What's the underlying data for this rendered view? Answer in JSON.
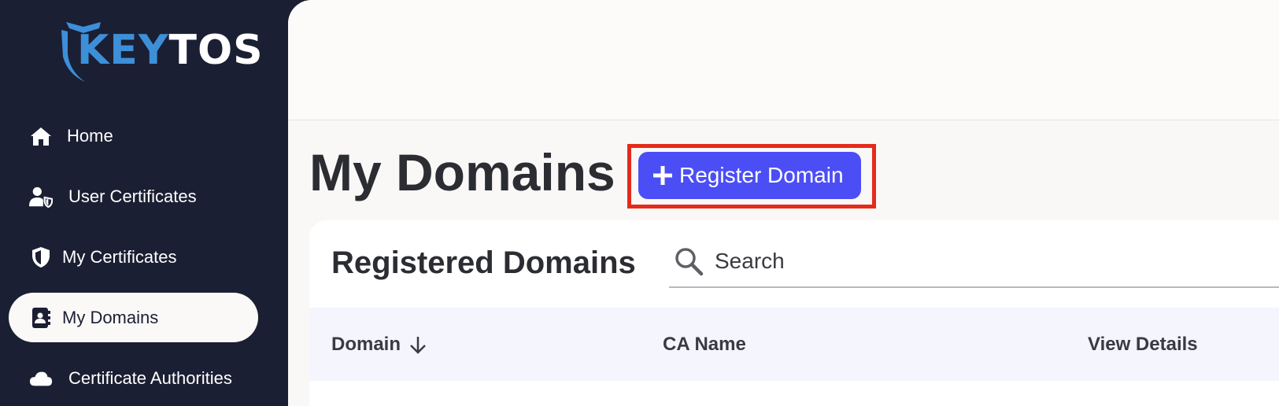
{
  "brand": {
    "logo_key": "KEY",
    "logo_tos": "TOS",
    "key_color": "#3d8fd8"
  },
  "sidebar": {
    "items": [
      {
        "label": "Home",
        "icon": "home-icon"
      },
      {
        "label": "User Certificates",
        "icon": "user-shield-icon"
      },
      {
        "label": "My Certificates",
        "icon": "shield-icon"
      },
      {
        "label": "My Domains",
        "icon": "contact-book-icon",
        "active": true
      },
      {
        "label": "Certificate Authorities",
        "icon": "cloud-icon"
      }
    ]
  },
  "main": {
    "page_title": "My Domains",
    "register_button": "Register Domain",
    "card": {
      "title": "Registered Domains",
      "search": {
        "placeholder": "Search",
        "value": ""
      },
      "columns": [
        "Domain",
        "CA Name",
        "View Details"
      ],
      "sort_column": "Domain",
      "sort_direction": "descending"
    }
  },
  "colors": {
    "sidebar_bg": "#1b1f33",
    "accent_button": "#4b4ef5",
    "highlight_border": "#e42b1b"
  }
}
